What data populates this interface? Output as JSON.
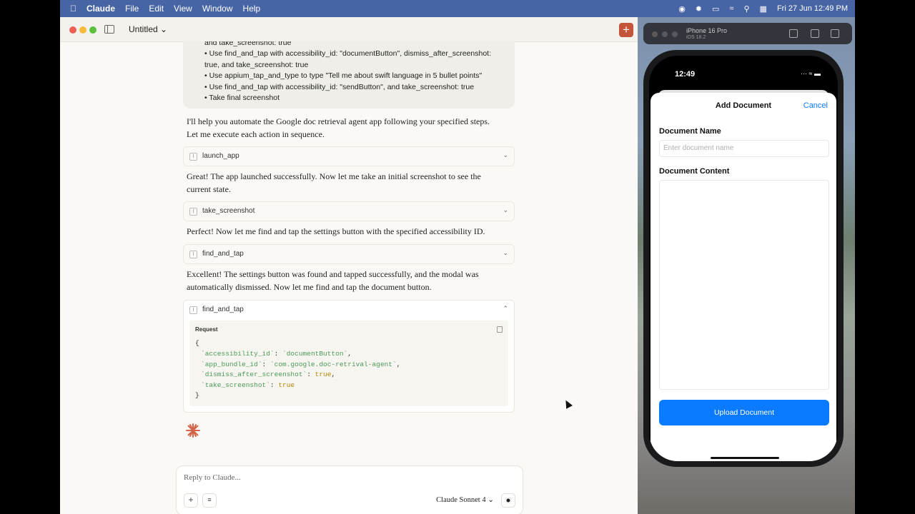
{
  "menubar": {
    "app": "Claude",
    "items": [
      "File",
      "Edit",
      "View",
      "Window",
      "Help"
    ],
    "datetime": "Fri 27 Jun  12:49 PM"
  },
  "window": {
    "title": "Untitled ⌄"
  },
  "user_message": {
    "lines": [
      "and take_screenshot: true",
      "• Use find_and_tap with accessibility_id: \"documentButton\", dismiss_after_screenshot:",
      "true, and take_screenshot: true",
      "• Use appium_tap_and_type to type \"Tell me about swift language in 5 bullet points\"",
      "• Use find_and_tap with accessibility_id: \"sendButton\", and take_screenshot: true",
      "• Take final screenshot"
    ]
  },
  "assistant": {
    "para1": "I'll help you automate the Google doc retrieval agent app following your specified steps. Let me execute each action in sequence.",
    "tool1": "launch_app",
    "para2": "Great! The app launched successfully. Now let me take an initial screenshot to see the current state.",
    "tool2": "take_screenshot",
    "para3": "Perfect! Now let me find and tap the settings button with the specified accessibility ID.",
    "tool3": "find_and_tap",
    "para4": "Excellent! The settings button was found and tapped successfully, and the modal was automatically dismissed. Now let me find and tap the document button.",
    "tool4": "find_and_tap",
    "request_label": "Request",
    "code_open": "{",
    "code_lines": [
      {
        "key": "`accessibility_id`",
        "sep": ": ",
        "val": "`documentButton`",
        "end": ","
      },
      {
        "key": "`app_bundle_id`",
        "sep": ": ",
        "val": "`com.google.doc-retrival-agent`",
        "end": ","
      },
      {
        "key": "`dismiss_after_screenshot`",
        "sep": ": ",
        "val": "true",
        "end": ","
      },
      {
        "key": "`take_screenshot`",
        "sep": ": ",
        "val": "true",
        "end": ""
      }
    ],
    "code_close": "}"
  },
  "composer": {
    "placeholder": "Reply to Claude...",
    "model": "Claude Sonnet 4 ⌄"
  },
  "simulator": {
    "device": "iPhone 16 Pro",
    "os": "iOS 18.2",
    "time": "12:49",
    "sheet_title": "Add Document",
    "cancel": "Cancel",
    "name_label": "Document Name",
    "name_placeholder": "Enter document name",
    "content_label": "Document Content",
    "upload": "Upload Document"
  },
  "colors": {
    "accent": "#c4553a",
    "ios_blue": "#0a7aff",
    "code_green": "#4c9a5a",
    "code_bool": "#b8860b"
  }
}
